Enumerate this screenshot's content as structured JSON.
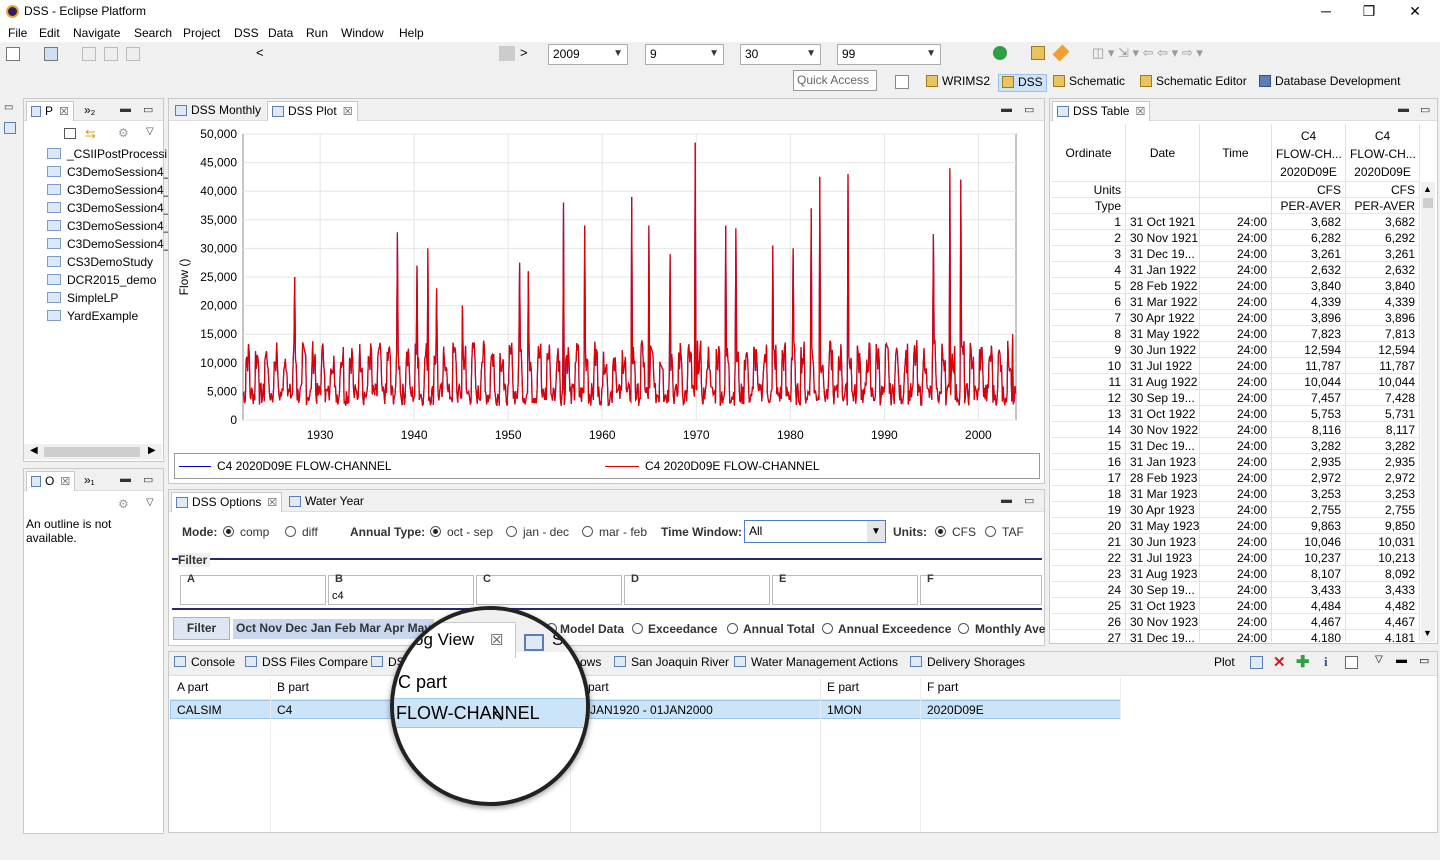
{
  "window": {
    "title": "DSS - Eclipse Platform",
    "minimize": "─",
    "maximize": "❐",
    "close": "✕"
  },
  "menu": [
    "File",
    "Edit",
    "Navigate",
    "Search",
    "Project",
    "DSS",
    "Data",
    "Run",
    "Window",
    "Help"
  ],
  "toolbar": {
    "nav_prev": "<",
    "nav_next": ">",
    "year": "2009",
    "month": "9",
    "day": "30",
    "end": "99",
    "quick_access_placeholder": "Quick Access"
  },
  "perspectives": [
    "WRIMS2",
    "DSS",
    "Schematic",
    "Schematic Editor",
    "Database Development"
  ],
  "project_panel": {
    "tab1": "P",
    "tab2": "»₂",
    "items": [
      "_CSIIPostProcessi",
      "C3DemoSession4_",
      "C3DemoSession4_",
      "C3DemoSession4_",
      "C3DemoSession4_",
      "C3DemoSession4_",
      "CS3DemoStudy",
      "DCR2015_demo",
      "SimpleLP",
      "YardExample"
    ]
  },
  "outline_panel": {
    "tab1": "O",
    "tab2": "»₁",
    "message": "An outline is not available."
  },
  "plot_panel": {
    "tabs": [
      "DSS Monthly",
      "DSS Plot"
    ],
    "legend": [
      "C4 2020D09E FLOW-CHANNEL",
      "C4 2020D09E FLOW-CHANNEL"
    ]
  },
  "chart_data": {
    "type": "line",
    "ylabel": "Flow ()",
    "xlabel": "",
    "ylim": [
      0,
      50000
    ],
    "xlim": [
      1921.8,
      2004
    ],
    "yticks": [
      "0",
      "5,000",
      "10,000",
      "15,000",
      "20,000",
      "25,000",
      "30,000",
      "35,000",
      "40,000",
      "45,000",
      "50,000"
    ],
    "xticks": [
      "1930",
      "1940",
      "1950",
      "1960",
      "1970",
      "1980",
      "1990",
      "2000"
    ],
    "series": [
      {
        "name": "C4 2020D09E FLOW-CHANNEL",
        "color": "#0000cc"
      },
      {
        "name": "C4 2020D09E FLOW-CHANNEL",
        "color": "#e00000"
      }
    ],
    "peaks": [
      {
        "x": 1927.3,
        "y": 25000
      },
      {
        "x": 1938.2,
        "y": 32800
      },
      {
        "x": 1940.3,
        "y": 27000
      },
      {
        "x": 1941.5,
        "y": 30000
      },
      {
        "x": 1942.4,
        "y": 23000
      },
      {
        "x": 1945.1,
        "y": 20000
      },
      {
        "x": 1951.2,
        "y": 27500
      },
      {
        "x": 1952.1,
        "y": 26000
      },
      {
        "x": 1955.9,
        "y": 38000
      },
      {
        "x": 1958.1,
        "y": 34000
      },
      {
        "x": 1963.1,
        "y": 39000
      },
      {
        "x": 1965.0,
        "y": 34000
      },
      {
        "x": 1967.2,
        "y": 29000
      },
      {
        "x": 1969.9,
        "y": 48500
      },
      {
        "x": 1973.1,
        "y": 34000
      },
      {
        "x": 1974.2,
        "y": 33500
      },
      {
        "x": 1978.1,
        "y": 30500
      },
      {
        "x": 1980.3,
        "y": 30000
      },
      {
        "x": 1982.2,
        "y": 37000
      },
      {
        "x": 1983.1,
        "y": 42500
      },
      {
        "x": 1986.1,
        "y": 43000
      },
      {
        "x": 1995.2,
        "y": 32500
      },
      {
        "x": 1997.0,
        "y": 44000
      },
      {
        "x": 1998.1,
        "y": 42000
      },
      {
        "x": 2003.6,
        "y": 15000
      }
    ]
  },
  "dss_table": {
    "tab": "DSS Table",
    "headers": {
      "ordinate": "Ordinate",
      "date": "Date",
      "time": "Time",
      "c1": [
        "C4",
        "FLOW-CH...",
        "2020D09E"
      ],
      "c2": [
        "C4",
        "FLOW-CH...",
        "2020D09E"
      ]
    },
    "units_label": "Units",
    "type_label": "Type",
    "units": [
      "CFS",
      "CFS"
    ],
    "types": [
      "PER-AVER",
      "PER-AVER"
    ],
    "rows": [
      [
        "1",
        "31 Oct 1921",
        "24:00",
        "3,682",
        "3,682"
      ],
      [
        "2",
        "30 Nov 1921",
        "24:00",
        "6,282",
        "6,292"
      ],
      [
        "3",
        "31 Dec 19...",
        "24:00",
        "3,261",
        "3,261"
      ],
      [
        "4",
        "31 Jan 1922",
        "24:00",
        "2,632",
        "2,632"
      ],
      [
        "5",
        "28 Feb 1922",
        "24:00",
        "3,840",
        "3,840"
      ],
      [
        "6",
        "31 Mar 1922",
        "24:00",
        "4,339",
        "4,339"
      ],
      [
        "7",
        "30 Apr 1922",
        "24:00",
        "3,896",
        "3,896"
      ],
      [
        "8",
        "31 May 1922",
        "24:00",
        "7,823",
        "7,813"
      ],
      [
        "9",
        "30 Jun 1922",
        "24:00",
        "12,594",
        "12,594"
      ],
      [
        "10",
        "31 Jul 1922",
        "24:00",
        "11,787",
        "11,787"
      ],
      [
        "11",
        "31 Aug 1922",
        "24:00",
        "10,044",
        "10,044"
      ],
      [
        "12",
        "30 Sep 19...",
        "24:00",
        "7,457",
        "7,428"
      ],
      [
        "13",
        "31 Oct 1922",
        "24:00",
        "5,753",
        "5,731"
      ],
      [
        "14",
        "30 Nov 1922",
        "24:00",
        "8,116",
        "8,117"
      ],
      [
        "15",
        "31 Dec 19...",
        "24:00",
        "3,282",
        "3,282"
      ],
      [
        "16",
        "31 Jan 1923",
        "24:00",
        "2,935",
        "2,935"
      ],
      [
        "17",
        "28 Feb 1923",
        "24:00",
        "2,972",
        "2,972"
      ],
      [
        "18",
        "31 Mar 1923",
        "24:00",
        "3,253",
        "3,253"
      ],
      [
        "19",
        "30 Apr 1923",
        "24:00",
        "2,755",
        "2,755"
      ],
      [
        "20",
        "31 May 1923",
        "24:00",
        "9,863",
        "9,850"
      ],
      [
        "21",
        "30 Jun 1923",
        "24:00",
        "10,046",
        "10,031"
      ],
      [
        "22",
        "31 Jul 1923",
        "24:00",
        "10,237",
        "10,213"
      ],
      [
        "23",
        "31 Aug 1923",
        "24:00",
        "8,107",
        "8,092"
      ],
      [
        "24",
        "30 Sep 19...",
        "24:00",
        "3,433",
        "3,433"
      ],
      [
        "25",
        "31 Oct 1923",
        "24:00",
        "4,484",
        "4,482"
      ],
      [
        "26",
        "30 Nov 1923",
        "24:00",
        "4,467",
        "4,467"
      ],
      [
        "27",
        "31 Dec 19...",
        "24:00",
        "4,180",
        "4,181"
      ]
    ]
  },
  "options_panel": {
    "tabs": [
      "DSS Options",
      "Water Year"
    ],
    "mode_label": "Mode:",
    "mode_opts": [
      "comp",
      "diff"
    ],
    "annual_label": "Annual Type:",
    "annual_opts": [
      "oct - sep",
      "jan - dec",
      "mar - feb"
    ],
    "window_label": "Time Window:",
    "window_value": "All",
    "units_label": "Units:",
    "unit_opts": [
      "CFS",
      "TAF"
    ],
    "filter_title": "Filter",
    "filter_labels": [
      "A",
      "B",
      "C",
      "D",
      "E",
      "F"
    ],
    "filter_values": [
      "",
      "c4",
      "",
      "",
      "",
      ""
    ],
    "filter_button": "Filter",
    "months": "Oct Nov Dec Jan Feb Mar Apr May",
    "view_opts": [
      "Model Data",
      "Exceedance",
      "Annual Total",
      "Annual Exceedence",
      "Monthly Ave"
    ]
  },
  "bottom_panel": {
    "tabs": [
      "Console",
      "DSS Files Compare",
      "DS",
      "og View",
      "St",
      "ows",
      "San Joaquin River",
      "Water Management Actions",
      "Delivery Shorages"
    ],
    "plot_label": "Plot",
    "columns": [
      "A part",
      "B part",
      "C part",
      "part",
      "E part",
      "F part"
    ],
    "row": [
      "CALSIM",
      "C4",
      "FLOW-CHANNEL",
      "JAN1920 - 01JAN2000",
      "1MON",
      "2020D09E"
    ]
  },
  "magnifier": {
    "tab": "og View",
    "tab2": "St",
    "col": "C part",
    "value": "FLOW-CHANNEL"
  }
}
